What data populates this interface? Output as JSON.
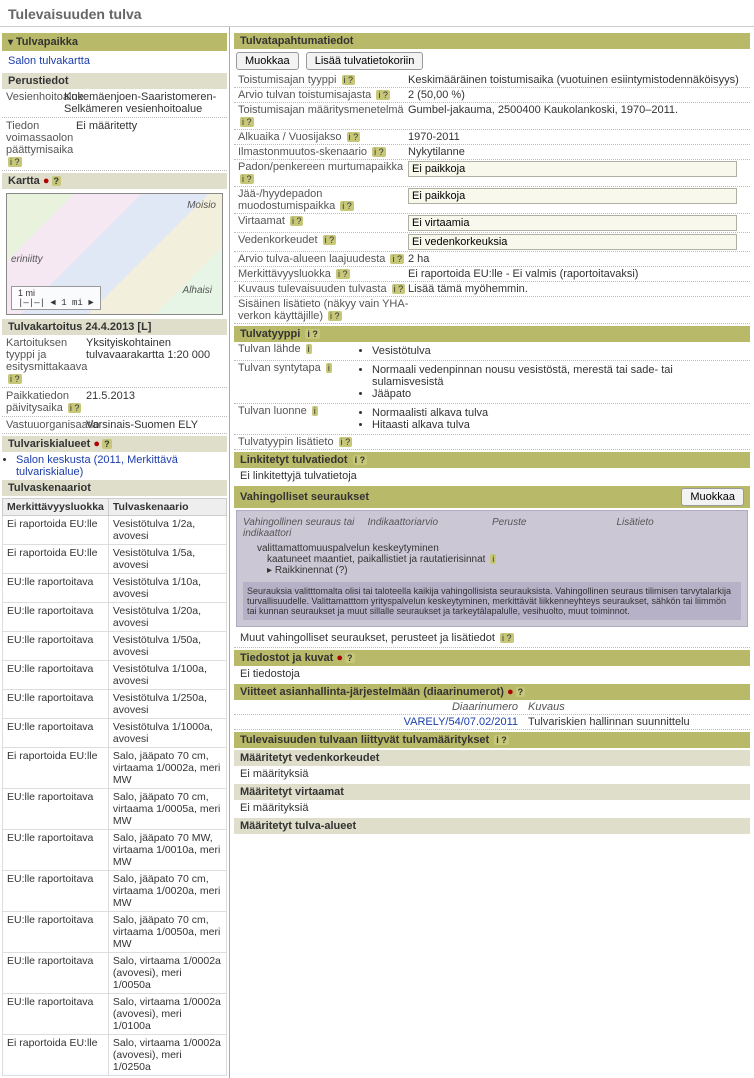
{
  "page_title": "Tulevaisuuden tulva",
  "left": {
    "tulvapaikka": "Tulvapaikka",
    "tulvakartta_link": "Salon tulvakartta",
    "perustiedot": "Perustiedot",
    "vesienhoitoalue_label": "Vesienhoitoalue",
    "vesienhoitoalue_value": "Kokemäenjoen-Saaristomeren-Selkämeren vesienhoitoalue",
    "tiedon_label": "Tiedon voimassaolon päättymisaika",
    "tiedon_value": "Ei määritetty",
    "kartta": "Kartta",
    "map_places": [
      "Moisio",
      "eriniitty",
      "Alhaisi"
    ],
    "map_scale": "1 mi",
    "tulvakartoitus": "Tulvakartoitus 24.4.2013 [L]",
    "kart_tyyppi_label": "Kartoituksen tyyppi ja esitysmittakaava",
    "kart_tyyppi_value": "Yksityiskohtainen tulvavaarakartta 1:20 000",
    "paikkatiedon_label": "Paikkatiedon päivitysaika",
    "paikkatiedon_value": "21.5.2013",
    "vastuu_label": "Vastuuorganisaatio",
    "vastuu_value": "Varsinais-Suomen ELY",
    "tulvariskialueet": "Tulvariskialueet",
    "riski_link": "Salon keskusta (2011, Merkittävä tulvariskialue)",
    "tulvaskenaariot": "Tulvaskenaariot",
    "skenaario_headers": [
      "Merkittävyysluokka",
      "Tulvaskenaario"
    ],
    "skenaariot": [
      [
        "Ei raportoida EU:lle",
        "Vesistötulva 1/2a, avovesi"
      ],
      [
        "Ei raportoida EU:lle",
        "Vesistötulva 1/5a, avovesi"
      ],
      [
        "EU:lle raportoitava",
        "Vesistötulva 1/10a, avovesi"
      ],
      [
        "EU:lle raportoitava",
        "Vesistötulva 1/20a, avovesi"
      ],
      [
        "EU:lle raportoitava",
        "Vesistötulva 1/50a, avovesi"
      ],
      [
        "EU:lle raportoitava",
        "Vesistötulva 1/100a, avovesi"
      ],
      [
        "EU:lle raportoitava",
        "Vesistötulva 1/250a, avovesi"
      ],
      [
        "EU:lle raportoitava",
        "Vesistötulva 1/1000a, avovesi"
      ],
      [
        "Ei raportoida EU:lle",
        "Salo, jääpato 70 cm, virtaama 1/0002a, meri MW"
      ],
      [
        "EU:lle raportoitava",
        "Salo, jääpato 70 cm, virtaama 1/0005a, meri MW"
      ],
      [
        "EU:lle raportoitava",
        "Salo, jääpato 70 MW, virtaama 1/0010a, meri MW"
      ],
      [
        "EU:lle raportoitava",
        "Salo, jääpato 70 cm, virtaama 1/0020a, meri MW"
      ],
      [
        "EU:lle raportoitava",
        "Salo, jääpato 70 cm, virtaama 1/0050a, meri MW"
      ],
      [
        "EU:lle raportoitava",
        "Salo, virtaama 1/0002a (avovesi), meri 1/0050a"
      ],
      [
        "EU:lle raportoitava",
        "Salo, virtaama 1/0002a (avovesi), meri 1/0100a"
      ],
      [
        "Ei raportoida EU:lle",
        "Salo, virtaama 1/0002a (avovesi), meri 1/0250a"
      ]
    ]
  },
  "right": {
    "tulvatapahtumatiedot": "Tulvatapahtumatiedot",
    "btn_muokkaa": "Muokkaa",
    "btn_lisaa_koriin": "Lisää tulvatietokoriin",
    "fields": [
      {
        "label": "Toistumisajan tyyppi",
        "val": "Keskimääräinen toistumisaika (vuotuinen esiintymistodennäköisyys)"
      },
      {
        "label": "Arvio tulvan toistumisajasta",
        "val": "2 (50,00 %)"
      },
      {
        "label": "Toistumisajan määritysmenetelmä",
        "val": "Gumbel-jakauma, 2500400 Kaukolankoski, 1970–2011."
      },
      {
        "label": "Alkuaika / Vuosijakso",
        "val": "1970-2011"
      },
      {
        "label": "Ilmastonmuutos-skenaario",
        "val": "Nykytilanne"
      }
    ],
    "input_fields": [
      {
        "label": "Padon/penkereen murtumapaikka",
        "val": "Ei paikkoja"
      },
      {
        "label": "Jää-/hyydepadon muodostumispaikka",
        "val": "Ei paikkoja"
      },
      {
        "label": "Virtaamat",
        "val": "Ei virtaamia"
      },
      {
        "label": "Vedenkorkeudet",
        "val": "Ei vedenkorkeuksia"
      }
    ],
    "arvio_laajuus_label": "Arvio tulva-alueen laajuudesta",
    "arvio_laajuus_val": "2 ha",
    "merk_luokka_label": "Merkittävyysluokka",
    "merk_luokka_val": "Ei raportoida EU:lle - Ei valmis (raportoitavaksi)",
    "kuvaus_label": "Kuvaus tulevaisuuden tulvasta",
    "kuvaus_val": "Lisää tämä myöhemmin.",
    "sisainen_label": "Sisäinen lisätieto (näkyy vain YHA-verkon käyttäjille)",
    "tulvatyyppi_header": "Tulvatyyppi",
    "tulvan_lahde_label": "Tulvan lähde",
    "tulvan_lahde_vals": [
      "Vesistötulva"
    ],
    "tulvan_syntytapa_label": "Tulvan syntytapa",
    "tulvan_syntytapa_vals": [
      "Normaali vedenpinnan nousu vesistöstä, merestä tai sade- tai sulamisvesistä",
      "Jääpato"
    ],
    "tulvan_luonne_label": "Tulvan luonne",
    "tulvan_luonne_vals": [
      "Normaalisti alkava tulva",
      "Hitaasti alkava tulva"
    ],
    "tulvatyypin_lisatieto": "Tulvatyypin lisätieto",
    "linkitetyt_header": "Linkitetyt tulvatiedot",
    "linkitetyt_none": "Ei linkitettyjä tulvatietoja",
    "vahingolliset_header": "Vahingolliset seuraukset",
    "vah_headers": [
      "Vahingollinen seuraus tai indikaattori",
      "Indikaattoriarvio",
      "Peruste",
      "Lisätieto"
    ],
    "vah_rows": [
      "valittamattomuuspalvelun keskeytyminen",
      "kaatuneet maantiet, paikallistiet ja rautatierisinnat",
      "Raikkinennat (?)"
    ],
    "vah_footnote": "Seurauksia valitttomalta olisi tai taloteella kaikija vahingollisista seurauksista. Vahingollinen seuraus tilimisen tarvytalarkija turvallisuudelle. Valittamatttom yrityspalvelun keskeytyminen, merkittävät liikkenneyhteys seuraukset, sähkön tai liimmön tai kunnan seuraukset ja muut sillalle seuraukset ja tarkeytälapalulle, vesihuolto, muut toiminnot.",
    "muut_vah_label": "Muut vahingolliset seuraukset, perusteet ja lisätiedot",
    "tiedostot_header": "Tiedostot ja kuvat",
    "tiedostot_none": "Ei tiedostoja",
    "viitteet_header": "Viitteet asianhallinta-järjestelmään (diaarinumerot)",
    "viitteet_headers": [
      "Diaarinumero",
      "Kuvaus"
    ],
    "viitteet_row": {
      "num": "VARELY/54/07.02/2011",
      "kuvaus": "Tulvariskien hallinnan suunnittelu"
    },
    "tuivaan_header": "Tulevaisuuden tulvaan liittyvät tulvamääritykset",
    "maar_vedenk": "Määritetyt vedenkorkeudet",
    "maar_vedenk_none": "Ei määrityksiä",
    "maar_virt": "Määritetyt virtaamat",
    "maar_virt_none": "Ei määrityksiä",
    "maar_alueet": "Määritetyt tulva-alueet"
  }
}
